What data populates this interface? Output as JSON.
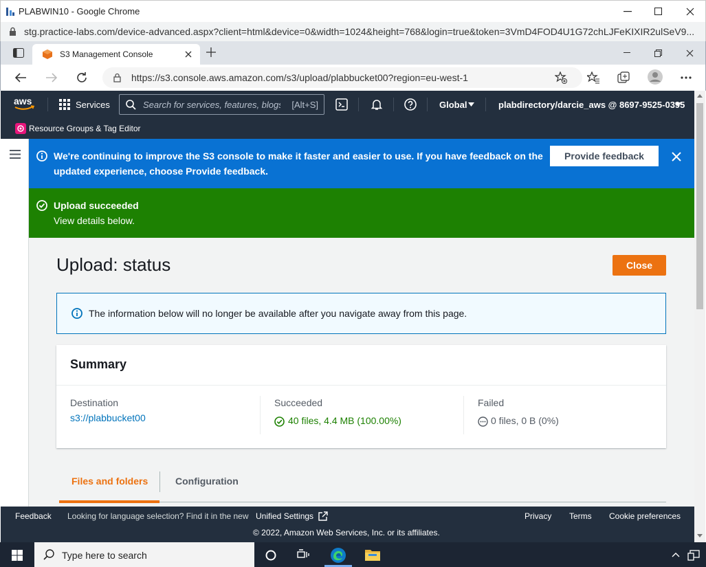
{
  "outer_window": {
    "title": "PLABWIN10 - Google Chrome",
    "url": "stg.practice-labs.com/device-advanced.aspx?client=html&device=0&width=1024&height=768&login=true&token=3VmD4FOD4U1G72chLJFeKIXIR2ulSeV9..."
  },
  "edge": {
    "tab_title": "S3 Management Console",
    "url": "https://s3.console.aws.amazon.com/s3/upload/plabbucket00?region=eu-west-1"
  },
  "aws_nav": {
    "logo": "aws",
    "services": "Services",
    "search_placeholder": "Search for services, features, blogs, docs, and more",
    "search_shortcut": "[Alt+S]",
    "region": "Global",
    "account": "plabdirectory/darcie_aws @ 8697-9525-0395",
    "resource_groups": "Resource Groups & Tag Editor"
  },
  "banner_info": {
    "text_line1": "We're continuing to improve the S3 console to make it faster and easier to use. If you have feedback on the",
    "text_line2_pre": "updated experience, choose ",
    "text_line2_bold": "Provide feedback",
    "text_line2_post": ".",
    "button": "Provide feedback"
  },
  "banner_success": {
    "title": "Upload succeeded",
    "subtitle": "View details below."
  },
  "page": {
    "title": "Upload: status",
    "close_button": "Close",
    "info_alert": "The information below will no longer be available after you navigate away from this page."
  },
  "summary": {
    "heading": "Summary",
    "destination_label": "Destination",
    "destination_value": "s3://plabbucket00",
    "succeeded_label": "Succeeded",
    "succeeded_value": "40 files, 4.4 MB (100.00%)",
    "failed_label": "Failed",
    "failed_value": "0 files, 0 B (0%)"
  },
  "tabs": [
    {
      "label": "Files and folders",
      "active": true
    },
    {
      "label": "Configuration",
      "active": false
    }
  ],
  "footer": {
    "feedback": "Feedback",
    "language_text": "Looking for language selection? Find it in the new",
    "unified_settings": "Unified Settings",
    "privacy": "Privacy",
    "terms": "Terms",
    "cookie": "Cookie preferences",
    "copyright": "© 2022, Amazon Web Services, Inc. or its affiliates."
  },
  "taskbar": {
    "search_placeholder": "Type here to search"
  },
  "colors": {
    "aws_nav": "#232f3e",
    "info_blue": "#0972d3",
    "success_green": "#1d8102",
    "orange": "#ec7211",
    "link_blue": "#0073bb"
  }
}
